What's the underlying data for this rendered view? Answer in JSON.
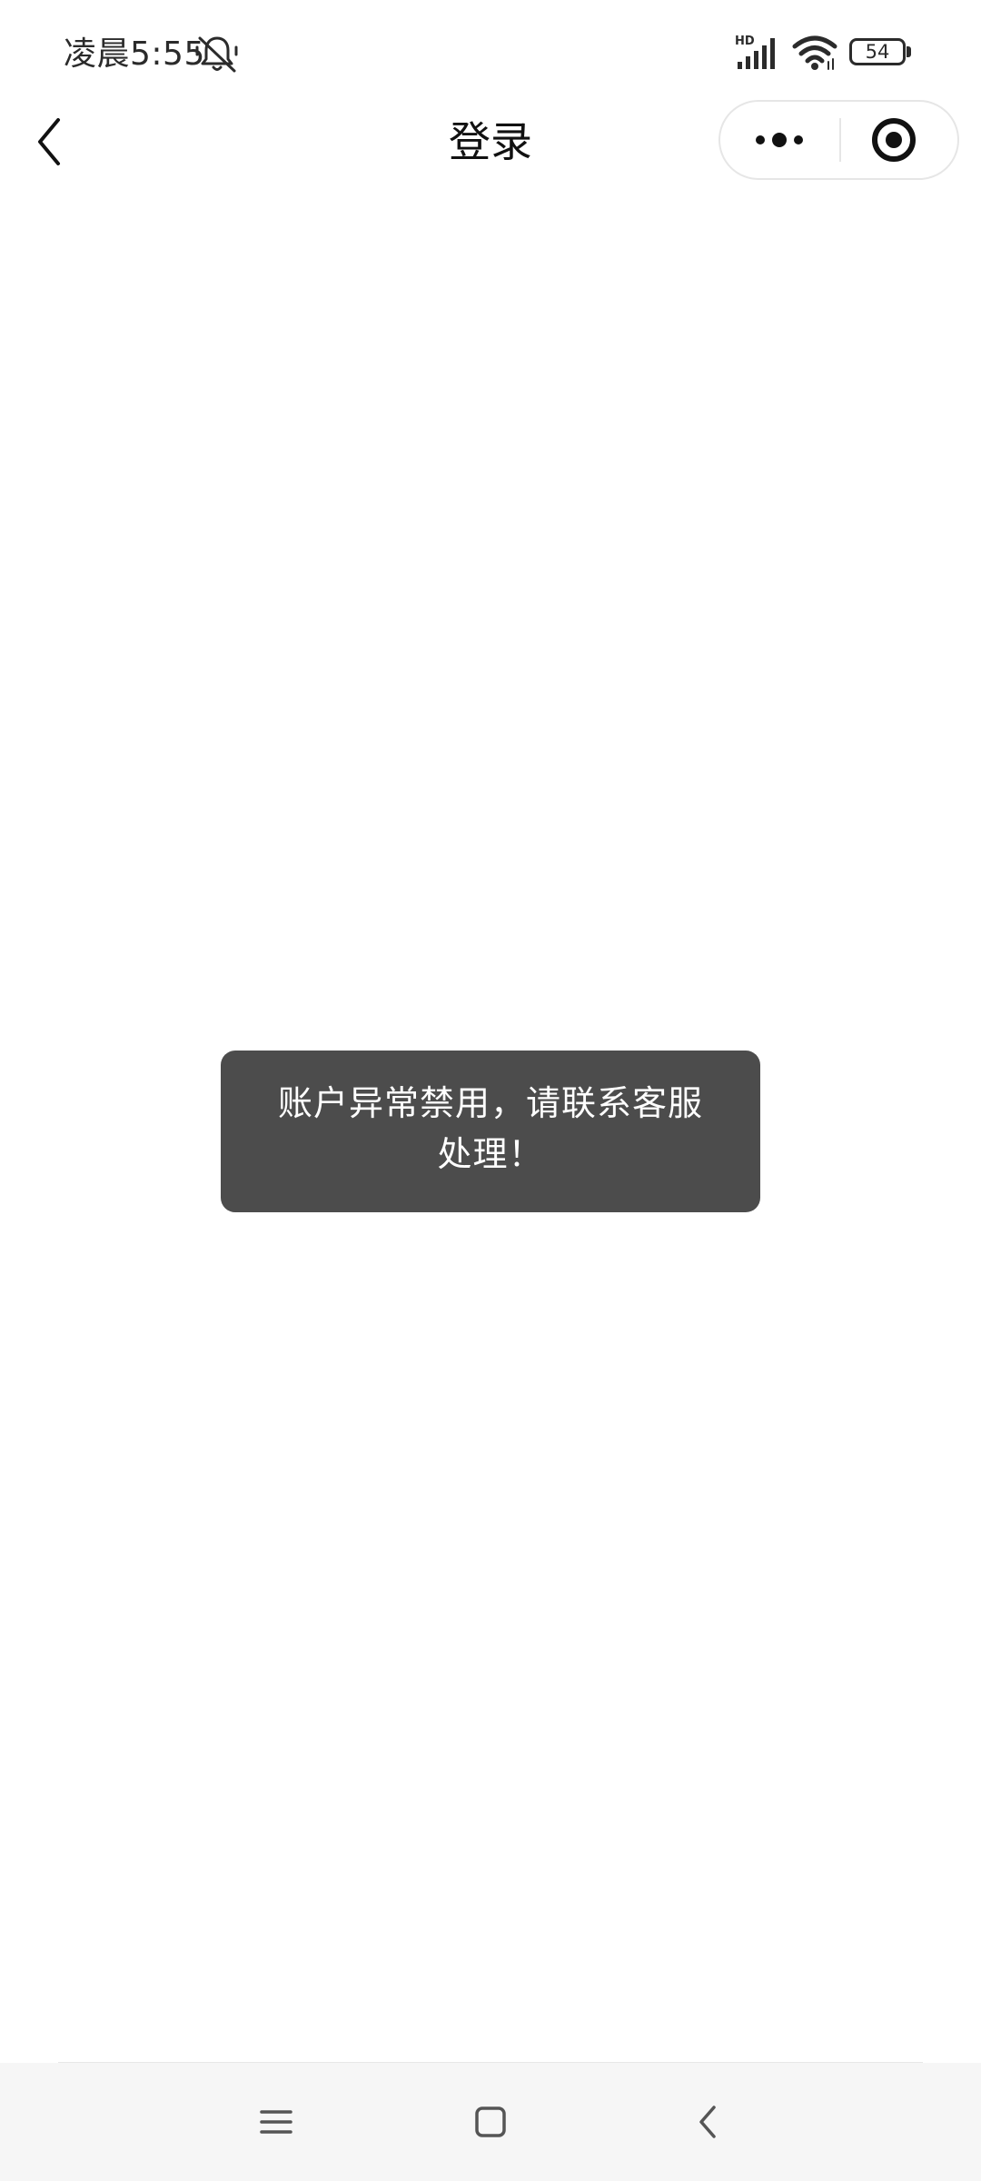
{
  "status_bar": {
    "time": "凌晨5:55",
    "signal_label": "HD",
    "battery_level": "54"
  },
  "nav": {
    "title": "登录"
  },
  "toast": {
    "line1": "账户异常禁用，请联系客服",
    "line2": "处理！"
  },
  "icons": {
    "status": [
      "mute-bell-icon",
      "hd-signal-icon",
      "wifi-icon",
      "battery-icon"
    ],
    "nav": [
      "back-chevron-icon",
      "more-dots-icon",
      "close-target-icon"
    ],
    "system": [
      "menu-lines-icon",
      "home-square-icon",
      "back-arrow-icon"
    ]
  },
  "colors": {
    "toast_background": "#4c4c4c",
    "system_nav_background": "#f6f6f6",
    "text_primary": "#111111"
  }
}
